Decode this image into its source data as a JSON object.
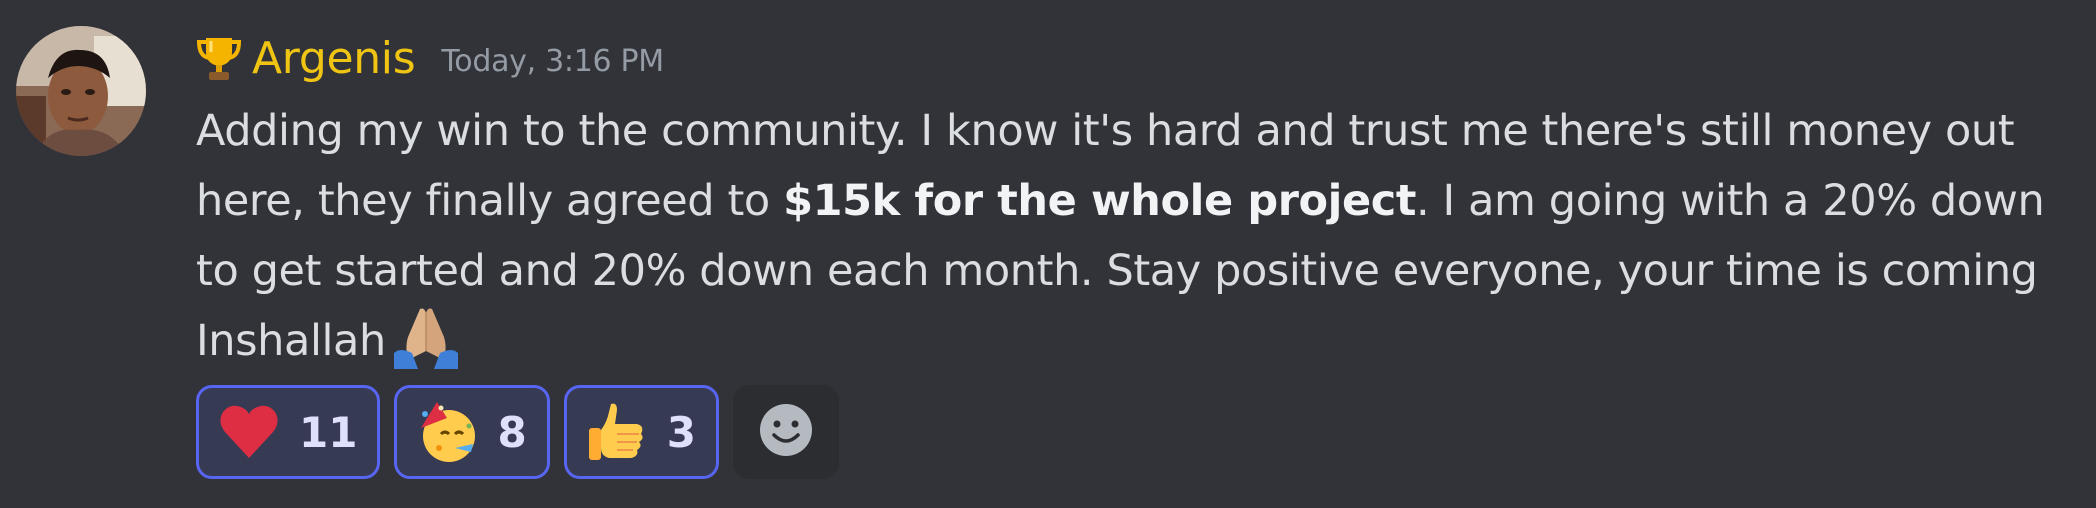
{
  "message": {
    "author": {
      "name": "Argenis",
      "name_color": "#f0c412",
      "badge_icon": "trophy-icon"
    },
    "timestamp": "Today, 3:16 PM",
    "content": {
      "text_before_bold": "Adding my win to the community. I know it's hard and trust me there's still money out here, they finally agreed to ",
      "bold_text": "$15k for the whole project",
      "text_after_bold": ". I am going with a 20% down to get started and 20% down each month. Stay positive everyone, your time is coming Inshallah",
      "trailing_emoji": "folded-hands-icon"
    },
    "reactions": [
      {
        "emoji": "heart-icon",
        "count": "11"
      },
      {
        "emoji": "party-face-icon",
        "count": "8"
      },
      {
        "emoji": "thumbs-up-icon",
        "count": "3"
      }
    ],
    "add_reaction_icon": "add-reaction-smiley-icon"
  },
  "colors": {
    "background": "#313338",
    "text": "#dbdee1",
    "timestamp": "#949ba4",
    "reaction_border": "#5865f2",
    "reaction_bg": "#373a53"
  }
}
